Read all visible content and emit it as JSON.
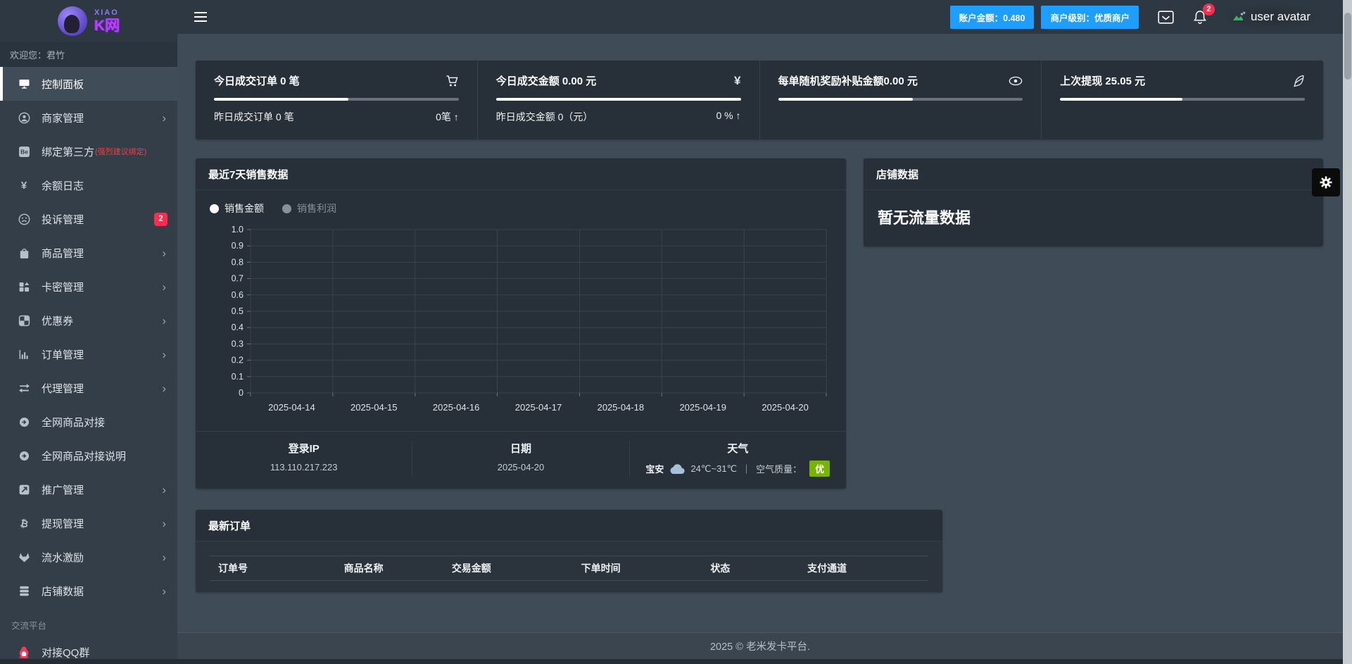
{
  "brand": {
    "top": "XIAO",
    "bottom": "K网"
  },
  "sidebar": {
    "welcome": "欢迎您：君竹",
    "section_label": "交流平台",
    "items": [
      {
        "label": "控制面板",
        "icon": "monitor-icon",
        "active": true
      },
      {
        "label": "商家管理",
        "icon": "user-circle-icon",
        "expandable": true
      },
      {
        "label": "绑定第三方",
        "icon": "behance-icon",
        "note": "(强烈建议绑定)"
      },
      {
        "label": "余额日志",
        "icon": "yen-icon"
      },
      {
        "label": "投诉管理",
        "icon": "frown-icon",
        "badge": "2"
      },
      {
        "label": "商品管理",
        "icon": "shopping-bag-icon",
        "expandable": true
      },
      {
        "label": "卡密管理",
        "icon": "grid-icon",
        "expandable": true
      },
      {
        "label": "优惠券",
        "icon": "checkerboard-icon",
        "expandable": true
      },
      {
        "label": "订单管理",
        "icon": "bar-chart-icon",
        "expandable": true
      },
      {
        "label": "代理管理",
        "icon": "exchange-arrows-icon",
        "expandable": true
      },
      {
        "label": "全网商品对接",
        "icon": "arrow-circle-right-icon"
      },
      {
        "label": "全网商品对接说明",
        "icon": "arrow-circle-right-icon"
      },
      {
        "label": "推广管理",
        "icon": "share-square-icon",
        "expandable": true
      },
      {
        "label": "提现管理",
        "icon": "bitcoin-icon",
        "expandable": true
      },
      {
        "label": "流水激励",
        "icon": "gitlab-icon",
        "expandable": true
      },
      {
        "label": "店铺数据",
        "icon": "database-icon",
        "expandable": true
      }
    ],
    "qq": {
      "label": "对接QQ群",
      "icon": "qq-penguin-icon"
    }
  },
  "topbar": {
    "account_badge": "账户金额：0.480",
    "level_badge": "商户级别：优质商户",
    "notification_count": "2",
    "avatar_alt": "user avatar"
  },
  "stats": {
    "cards": [
      {
        "title": "今日成交订单 0 笔",
        "icon": "cart-icon",
        "progress": 55,
        "sub_left": "昨日成交订单 0 笔",
        "sub_right": "0笔 ↑"
      },
      {
        "title": "今日成交金额 0.00 元",
        "icon": "yen-icon",
        "progress": 100,
        "sub_left": "昨日成交金额 0（元）",
        "sub_right": "0 % ↑"
      },
      {
        "title": "每单随机奖励补贴金额0.00 元",
        "icon": "eye-icon",
        "progress": 55
      },
      {
        "title": "上次提现 25.05 元",
        "icon": "quill-icon",
        "progress": 50
      }
    ]
  },
  "sales_panel": {
    "title": "最近7天销售数据",
    "legend": [
      {
        "label": "销售金额",
        "color": "#ffffff",
        "selected": true
      },
      {
        "label": "销售利润",
        "color": "#878f98",
        "selected": false
      }
    ]
  },
  "chart_data": {
    "type": "line",
    "title": "最近7天销售数据",
    "categories": [
      "2025-04-14",
      "2025-04-15",
      "2025-04-16",
      "2025-04-17",
      "2025-04-18",
      "2025-04-19",
      "2025-04-20"
    ],
    "series": [
      {
        "name": "销售金额",
        "values": []
      },
      {
        "name": "销售利润",
        "values": []
      }
    ],
    "ylim": [
      0,
      1
    ],
    "yticks": [
      "1.0",
      "0.9",
      "0.8",
      "0.7",
      "0.6",
      "0.5",
      "0.4",
      "0.3",
      "0.2",
      "0.1",
      "0"
    ],
    "grid": true,
    "legend_position": "top-left",
    "note": "empty chart - no data plotted"
  },
  "info_row": {
    "login_ip": {
      "title": "登录IP",
      "value": "113.110.217.223"
    },
    "date": {
      "title": "日期",
      "value": "2025-04-20"
    },
    "weather": {
      "title": "天气",
      "city": "宝安",
      "temp": "24℃~31℃",
      "separator": "｜",
      "aqi_label": "空气质量：",
      "aqi_value": "优"
    }
  },
  "shop_panel": {
    "title": "店铺数据",
    "empty_text": "暂无流量数据"
  },
  "orders_panel": {
    "title": "最新订单",
    "columns": [
      "订单号",
      "商品名称",
      "交易金额",
      "下单时间",
      "状态",
      "支付通道"
    ],
    "rows": []
  },
  "footer": {
    "copyright": "2025 © 老米发卡平台."
  },
  "colors": {
    "accent_blue": "#1e9fff",
    "badge_red": "#fb2c4c",
    "aqi_green": "#76b400",
    "brand_purple": "#c63cf0",
    "panel_bg": "#272f38",
    "page_bg": "#3f4b57"
  }
}
